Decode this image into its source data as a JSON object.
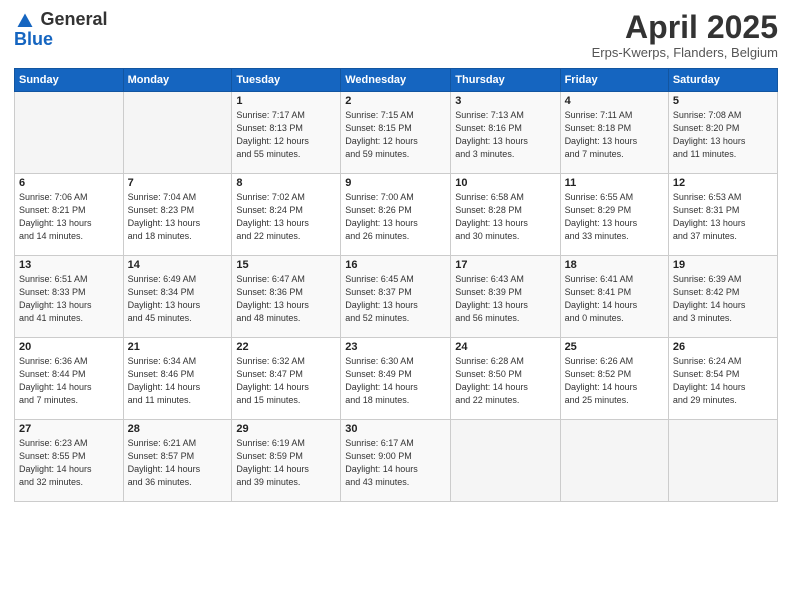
{
  "header": {
    "logo_general": "General",
    "logo_blue": "Blue",
    "month": "April 2025",
    "location": "Erps-Kwerps, Flanders, Belgium"
  },
  "weekdays": [
    "Sunday",
    "Monday",
    "Tuesday",
    "Wednesday",
    "Thursday",
    "Friday",
    "Saturday"
  ],
  "weeks": [
    [
      {
        "day": "",
        "info": ""
      },
      {
        "day": "",
        "info": ""
      },
      {
        "day": "1",
        "info": "Sunrise: 7:17 AM\nSunset: 8:13 PM\nDaylight: 12 hours\nand 55 minutes."
      },
      {
        "day": "2",
        "info": "Sunrise: 7:15 AM\nSunset: 8:15 PM\nDaylight: 12 hours\nand 59 minutes."
      },
      {
        "day": "3",
        "info": "Sunrise: 7:13 AM\nSunset: 8:16 PM\nDaylight: 13 hours\nand 3 minutes."
      },
      {
        "day": "4",
        "info": "Sunrise: 7:11 AM\nSunset: 8:18 PM\nDaylight: 13 hours\nand 7 minutes."
      },
      {
        "day": "5",
        "info": "Sunrise: 7:08 AM\nSunset: 8:20 PM\nDaylight: 13 hours\nand 11 minutes."
      }
    ],
    [
      {
        "day": "6",
        "info": "Sunrise: 7:06 AM\nSunset: 8:21 PM\nDaylight: 13 hours\nand 14 minutes."
      },
      {
        "day": "7",
        "info": "Sunrise: 7:04 AM\nSunset: 8:23 PM\nDaylight: 13 hours\nand 18 minutes."
      },
      {
        "day": "8",
        "info": "Sunrise: 7:02 AM\nSunset: 8:24 PM\nDaylight: 13 hours\nand 22 minutes."
      },
      {
        "day": "9",
        "info": "Sunrise: 7:00 AM\nSunset: 8:26 PM\nDaylight: 13 hours\nand 26 minutes."
      },
      {
        "day": "10",
        "info": "Sunrise: 6:58 AM\nSunset: 8:28 PM\nDaylight: 13 hours\nand 30 minutes."
      },
      {
        "day": "11",
        "info": "Sunrise: 6:55 AM\nSunset: 8:29 PM\nDaylight: 13 hours\nand 33 minutes."
      },
      {
        "day": "12",
        "info": "Sunrise: 6:53 AM\nSunset: 8:31 PM\nDaylight: 13 hours\nand 37 minutes."
      }
    ],
    [
      {
        "day": "13",
        "info": "Sunrise: 6:51 AM\nSunset: 8:33 PM\nDaylight: 13 hours\nand 41 minutes."
      },
      {
        "day": "14",
        "info": "Sunrise: 6:49 AM\nSunset: 8:34 PM\nDaylight: 13 hours\nand 45 minutes."
      },
      {
        "day": "15",
        "info": "Sunrise: 6:47 AM\nSunset: 8:36 PM\nDaylight: 13 hours\nand 48 minutes."
      },
      {
        "day": "16",
        "info": "Sunrise: 6:45 AM\nSunset: 8:37 PM\nDaylight: 13 hours\nand 52 minutes."
      },
      {
        "day": "17",
        "info": "Sunrise: 6:43 AM\nSunset: 8:39 PM\nDaylight: 13 hours\nand 56 minutes."
      },
      {
        "day": "18",
        "info": "Sunrise: 6:41 AM\nSunset: 8:41 PM\nDaylight: 14 hours\nand 0 minutes."
      },
      {
        "day": "19",
        "info": "Sunrise: 6:39 AM\nSunset: 8:42 PM\nDaylight: 14 hours\nand 3 minutes."
      }
    ],
    [
      {
        "day": "20",
        "info": "Sunrise: 6:36 AM\nSunset: 8:44 PM\nDaylight: 14 hours\nand 7 minutes."
      },
      {
        "day": "21",
        "info": "Sunrise: 6:34 AM\nSunset: 8:46 PM\nDaylight: 14 hours\nand 11 minutes."
      },
      {
        "day": "22",
        "info": "Sunrise: 6:32 AM\nSunset: 8:47 PM\nDaylight: 14 hours\nand 15 minutes."
      },
      {
        "day": "23",
        "info": "Sunrise: 6:30 AM\nSunset: 8:49 PM\nDaylight: 14 hours\nand 18 minutes."
      },
      {
        "day": "24",
        "info": "Sunrise: 6:28 AM\nSunset: 8:50 PM\nDaylight: 14 hours\nand 22 minutes."
      },
      {
        "day": "25",
        "info": "Sunrise: 6:26 AM\nSunset: 8:52 PM\nDaylight: 14 hours\nand 25 minutes."
      },
      {
        "day": "26",
        "info": "Sunrise: 6:24 AM\nSunset: 8:54 PM\nDaylight: 14 hours\nand 29 minutes."
      }
    ],
    [
      {
        "day": "27",
        "info": "Sunrise: 6:23 AM\nSunset: 8:55 PM\nDaylight: 14 hours\nand 32 minutes."
      },
      {
        "day": "28",
        "info": "Sunrise: 6:21 AM\nSunset: 8:57 PM\nDaylight: 14 hours\nand 36 minutes."
      },
      {
        "day": "29",
        "info": "Sunrise: 6:19 AM\nSunset: 8:59 PM\nDaylight: 14 hours\nand 39 minutes."
      },
      {
        "day": "30",
        "info": "Sunrise: 6:17 AM\nSunset: 9:00 PM\nDaylight: 14 hours\nand 43 minutes."
      },
      {
        "day": "",
        "info": ""
      },
      {
        "day": "",
        "info": ""
      },
      {
        "day": "",
        "info": ""
      }
    ]
  ]
}
